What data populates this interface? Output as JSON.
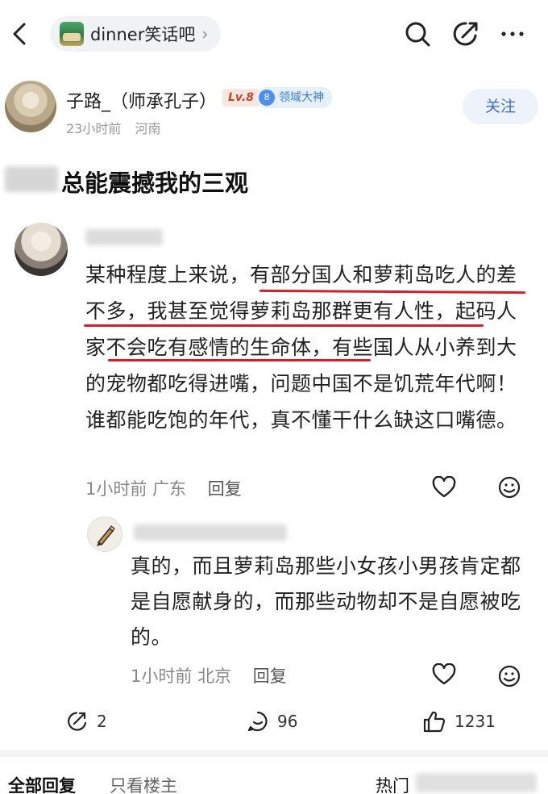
{
  "nav": {
    "forum_name": "dinner笑话吧",
    "forum_chevron": "›"
  },
  "author": {
    "name": "子路_（师承孔子）",
    "level": "Lv.8",
    "domain_level": "8",
    "domain_title": "领域大神",
    "time": "23小时前",
    "location": "河南",
    "follow_label": "关注"
  },
  "post": {
    "title": "总能震撼我的三观"
  },
  "comment": {
    "text": "某种程度上来说，有部分国人和萝莉岛吃人的差不多，我甚至觉得萝莉岛那群更有人性，起码人家不会吃有感情的生命体，有些国人从小养到大的宠物都吃得进嘴，问题中国不是饥荒年代啊！谁都能吃饱的年代，真不懂干什么缺这口嘴德。",
    "time": "1小时前",
    "location": "广东",
    "reply_label": "回复"
  },
  "sub_reply": {
    "text": "真的，而且萝莉岛那些小女孩小男孩肯定都是自愿献身的，而那些动物却不是自愿被吃的。",
    "time": "1小时前",
    "location": "北京",
    "reply_label": "回复"
  },
  "actions": {
    "share_count": "2",
    "comment_count": "96",
    "like_count": "1231"
  },
  "tabs": {
    "all_replies": "全部回复",
    "op_only": "只看楼主",
    "hot": "热门"
  },
  "colors": {
    "highlight_underline": "#d21f2a",
    "link_blue": "#3a6fd6",
    "level_red": "#c14a33"
  }
}
